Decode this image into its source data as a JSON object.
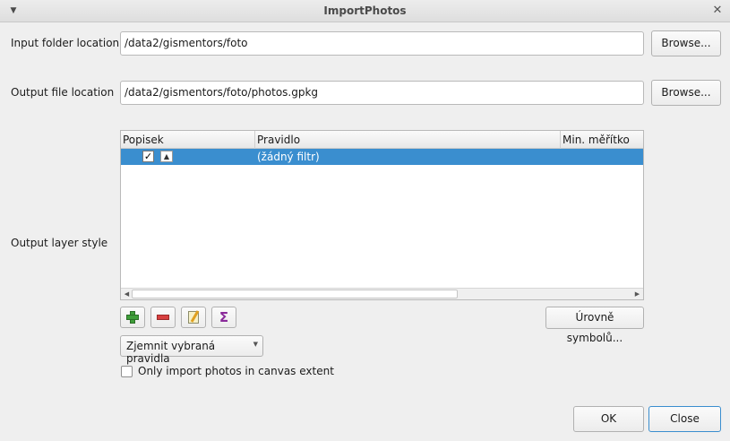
{
  "window": {
    "title": "ImportPhotos"
  },
  "input_folder": {
    "label": "Input folder location",
    "value": "/data2/gismentors/foto",
    "browse_label": "Browse..."
  },
  "output_file": {
    "label": "Output file location",
    "value": "/data2/gismentors/foto/photos.gpkg",
    "browse_label": "Browse..."
  },
  "style": {
    "label": "Output layer style",
    "columns": [
      "Popisek",
      "Pravidlo",
      "Min. měřítko"
    ],
    "rows": [
      {
        "checked": true,
        "rule": "(žádný filtr)"
      }
    ],
    "symbol_levels_label": "Úrovně symbolů...",
    "refine_label": "Zjemnit vybraná pravidla",
    "tools": [
      "add-rule-icon",
      "remove-rule-icon",
      "edit-rule-icon",
      "count-features-icon"
    ]
  },
  "canvas_extent": {
    "label": "Only import photos in canvas extent",
    "checked": false
  },
  "buttons": {
    "ok": "OK",
    "close": "Close"
  },
  "colors": {
    "selection": "#3a8ecf"
  }
}
